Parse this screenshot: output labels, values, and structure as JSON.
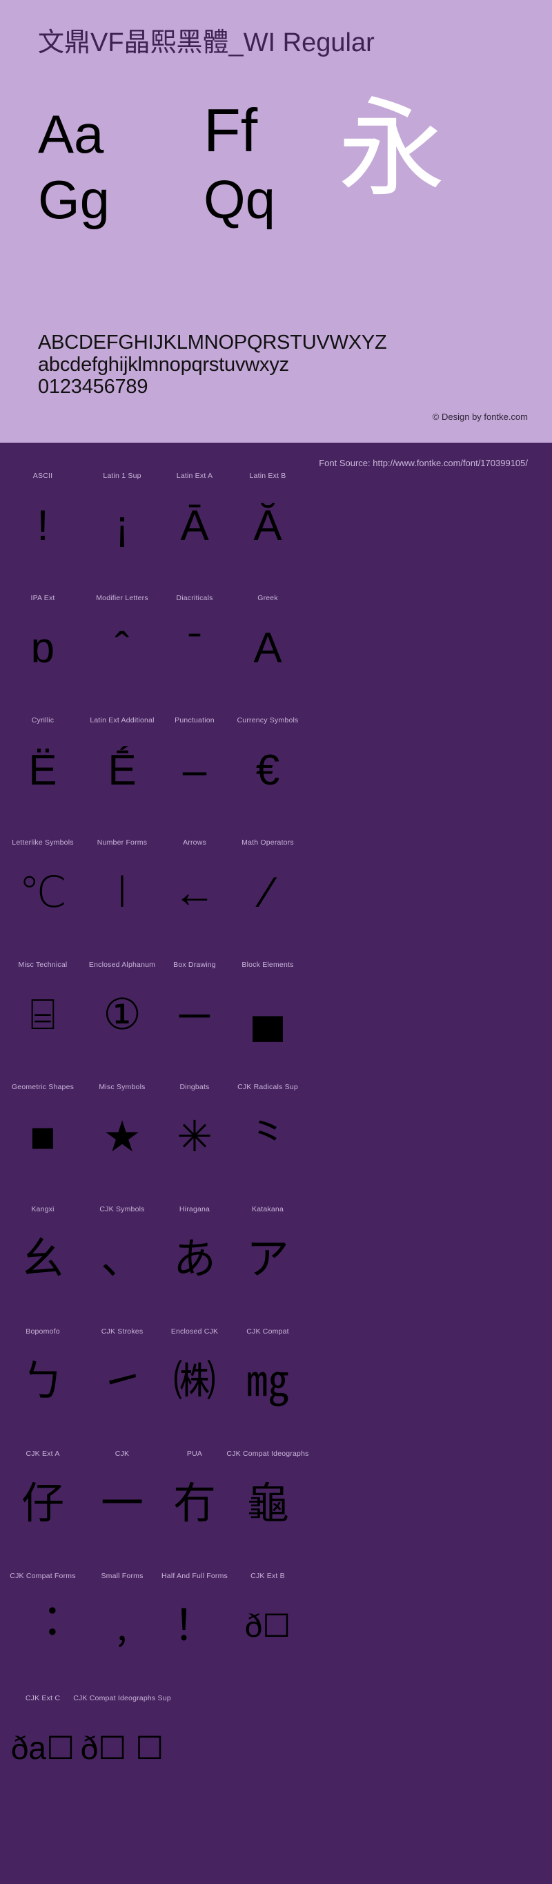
{
  "specimen": {
    "title": "文鼎VF晶熙黑體_WI Regular",
    "samples": {
      "upper_lower_1": "Aa",
      "upper_lower_2": "Ff",
      "upper_lower_3": "Gg",
      "upper_lower_4": "Qq",
      "cjk_sample": "永"
    },
    "charset": {
      "uppercase": "ABCDEFGHIJKLMNOPQRSTUVWXYZ",
      "lowercase": "abcdefghijklmnopqrstuvwxyz",
      "digits": "0123456789"
    },
    "copyright": "© Design by fontke.com"
  },
  "blocks_panel": {
    "font_source": "Font Source: http://www.fontke.com/font/170399105/",
    "rows": [
      [
        {
          "label": "ASCII",
          "glyph": "!"
        },
        {
          "label": "Latin 1 Sup",
          "glyph": "¡"
        },
        {
          "label": "Latin Ext A",
          "glyph": "Ā"
        },
        {
          "label": "Latin Ext B",
          "glyph": "Ă"
        }
      ],
      [
        {
          "label": "IPA Ext",
          "glyph": "ɒ"
        },
        {
          "label": "Modifier Letters",
          "glyph": "ˆ"
        },
        {
          "label": "Diacriticals",
          "glyph": "̄"
        },
        {
          "label": "Greek",
          "glyph": "Α"
        }
      ],
      [
        {
          "label": "Cyrillic",
          "glyph": "Ё"
        },
        {
          "label": "Latin Ext Additional",
          "glyph": "Ḗ"
        },
        {
          "label": "Punctuation",
          "glyph": "‒"
        },
        {
          "label": "Currency Symbols",
          "glyph": "€"
        }
      ],
      [
        {
          "label": "Letterlike Symbols",
          "glyph": "℃"
        },
        {
          "label": "Number Forms",
          "glyph": "Ⅰ"
        },
        {
          "label": "Arrows",
          "glyph": "←"
        },
        {
          "label": "Math Operators",
          "glyph": "∕"
        }
      ],
      [
        {
          "label": "Misc Technical",
          "glyph": "⌸"
        },
        {
          "label": "Enclosed Alphanum",
          "glyph": "①"
        },
        {
          "label": "Box Drawing",
          "glyph": "─"
        },
        {
          "label": "Block Elements",
          "glyph": "▄"
        }
      ],
      [
        {
          "label": "Geometric Shapes",
          "glyph": "■"
        },
        {
          "label": "Misc Symbols",
          "glyph": "★"
        },
        {
          "label": "Dingbats",
          "glyph": "✳"
        },
        {
          "label": "CJK Radicals Sup",
          "glyph": "⺀"
        }
      ],
      [
        {
          "label": "Kangxi",
          "glyph": "幺"
        },
        {
          "label": "CJK Symbols",
          "glyph": "、"
        },
        {
          "label": "Hiragana",
          "glyph": "あ"
        },
        {
          "label": "Katakana",
          "glyph": "ア"
        }
      ],
      [
        {
          "label": "Bopomofo",
          "glyph": "ㄅ"
        },
        {
          "label": "CJK Strokes",
          "glyph": "㇀"
        },
        {
          "label": "Enclosed CJK",
          "glyph": "㈱"
        },
        {
          "label": "CJK Compat",
          "glyph": "㎎"
        }
      ],
      [
        {
          "label": "CJK Ext A",
          "glyph": "仔"
        },
        {
          "label": "CJK",
          "glyph": "一"
        },
        {
          "label": "PUA",
          "glyph": "冇"
        },
        {
          "label": "CJK Compat Ideographs",
          "glyph": "龜"
        }
      ],
      [
        {
          "label": "CJK Compat Forms",
          "glyph": "︓"
        },
        {
          "label": "Small Forms",
          "glyph": "﹐"
        },
        {
          "label": "Half And Full Forms",
          "glyph": "！"
        },
        {
          "label": "CJK Ext B",
          "glyph": "ð☐"
        }
      ],
      [
        {
          "label": "CJK Ext C",
          "glyph": "ða☐"
        },
        {
          "label": "CJK Compat Ideographs Sup",
          "glyph": "ð☐ ☐"
        },
        {
          "label": "",
          "glyph": ""
        },
        {
          "label": "",
          "glyph": ""
        }
      ]
    ]
  }
}
